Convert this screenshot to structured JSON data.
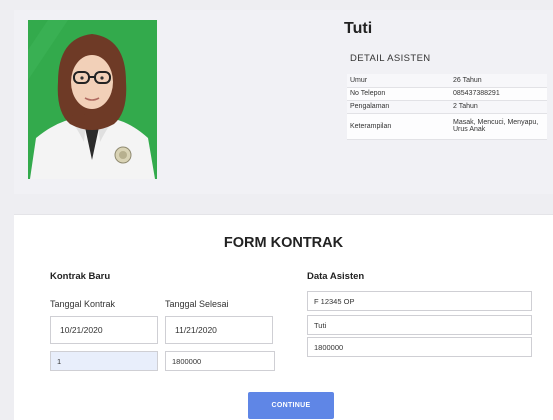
{
  "profile": {
    "name": "Tuti",
    "detail_title": "DETAIL ASISTEN",
    "details": [
      {
        "key": "Umur",
        "value": "26 Tahun"
      },
      {
        "key": "No Telepon",
        "value": "085437388291"
      },
      {
        "key": "Pengalaman",
        "value": "2 Tahun"
      },
      {
        "key": "Keterampilan",
        "value": "Masak, Mencuci, Menyapu, Urus Anak"
      }
    ]
  },
  "form": {
    "title": "FORM KONTRAK",
    "kontrak": {
      "heading": "Kontrak Baru",
      "tanggal_kontrak_label": "Tanggal Kontrak",
      "tanggal_selesai_label": "Tanggal Selesai",
      "tanggal_kontrak_value": "10/21/2020",
      "tanggal_selesai_value": "11/21/2020",
      "durasi_value": "1",
      "total_value": "1800000"
    },
    "asisten": {
      "heading": "Data Asisten",
      "kode_value": "F 12345 OP",
      "nama_value": "Tuti",
      "gaji_value": "1800000"
    },
    "continue_label": "CONTINUE"
  },
  "colors": {
    "photo_background": "#2fa84a",
    "button": "#5f86e6",
    "filled_field": "#e8eefb"
  }
}
